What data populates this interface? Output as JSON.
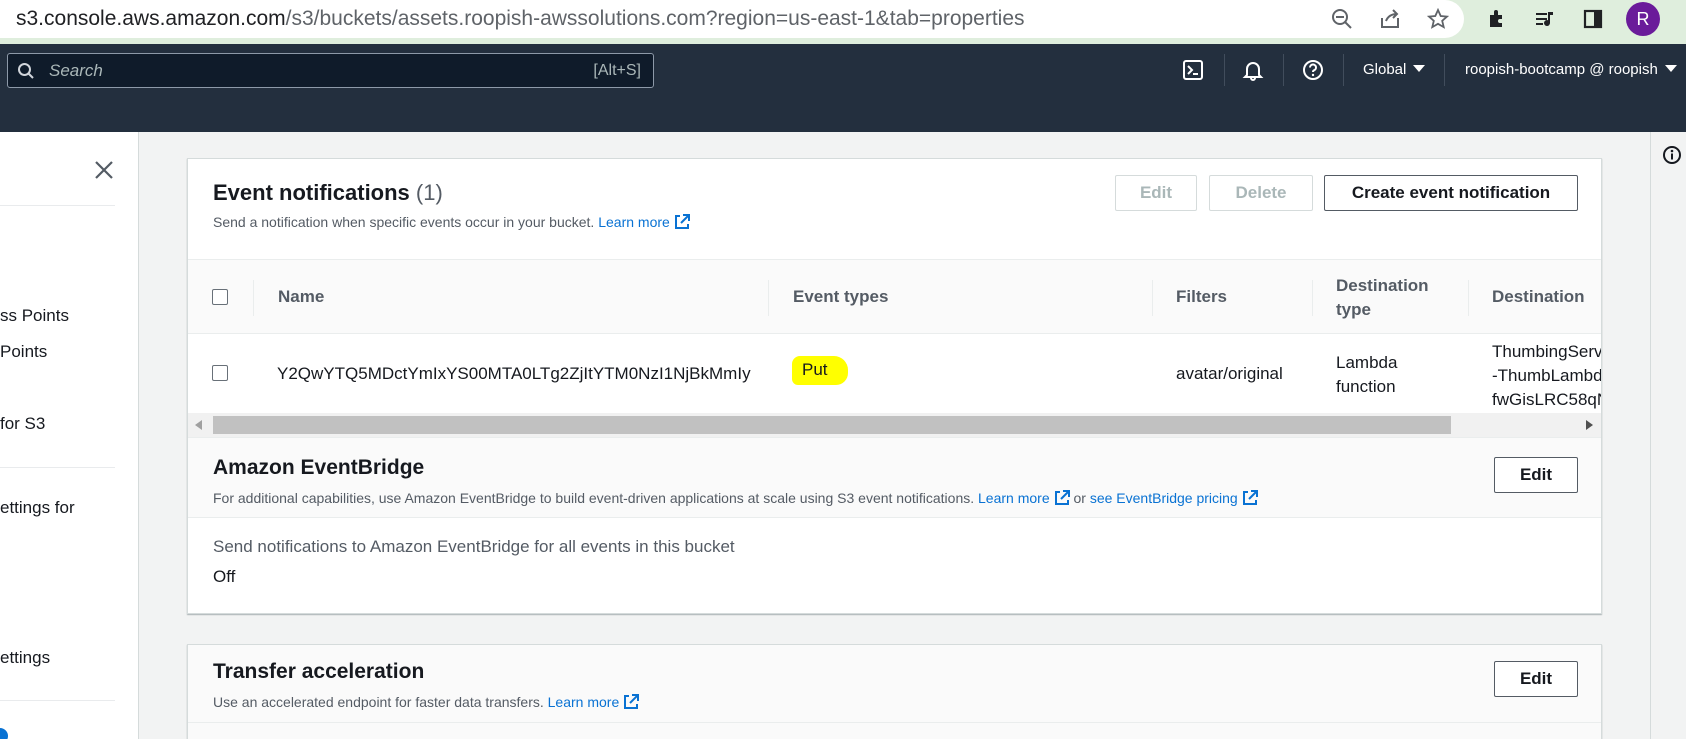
{
  "browser": {
    "url_host": "s3.console.aws.amazon.com",
    "url_path": "/s3/buckets/assets.roopish-awssolutions.com?region=us-east-1&tab=properties",
    "avatar_letter": "R"
  },
  "aws_nav": {
    "search_placeholder": "Search",
    "search_shortcut": "[Alt+S]",
    "region": "Global",
    "account": "roopish-bootcamp @ roopish"
  },
  "drawer": {
    "items": [
      "ss Points",
      "Points",
      "for S3",
      "ettings for",
      "ettings"
    ]
  },
  "event_notifications": {
    "title": "Event notifications",
    "count": "(1)",
    "description": "Send a notification when specific events occur in your bucket.",
    "learn_more": "Learn more",
    "edit_label": "Edit",
    "delete_label": "Delete",
    "create_label": "Create event notification",
    "columns": {
      "name": "Name",
      "event_types": "Event types",
      "filters": "Filters",
      "destination_type_1": "Destination",
      "destination_type_2": "type",
      "destination": "Destination"
    },
    "row": {
      "name": "Y2QwYTQ5MDctYmIxYS00MTA0LTg2ZjItYTM0NzI1NjBkMmIy",
      "event_type": "Put",
      "filter": "avatar/original",
      "destination_type_1": "Lambda",
      "destination_type_2": "function",
      "destination_1": "ThumbingServ",
      "destination_2": "-ThumbLambd",
      "destination_3": "fwGisLRC58qN"
    }
  },
  "eventbridge": {
    "title": "Amazon EventBridge",
    "description": "For additional capabilities, use Amazon EventBridge to build event-driven applications at scale using S3 event notifications.",
    "learn_more": "Learn more",
    "or_text": "or",
    "pricing_link": "see EventBridge pricing",
    "edit_label": "Edit",
    "setting_label": "Send notifications to Amazon EventBridge for all events in this bucket",
    "setting_value": "Off"
  },
  "transfer_acceleration": {
    "title": "Transfer acceleration",
    "description": "Use an accelerated endpoint for faster data transfers.",
    "learn_more": "Learn more",
    "edit_label": "Edit"
  },
  "colors": {
    "aws_nav": "#232f3e",
    "link": "#0972d3",
    "highlight": "#ffff00",
    "browser_frame": "#dfeedd",
    "avatar": "#6a1b9a"
  }
}
